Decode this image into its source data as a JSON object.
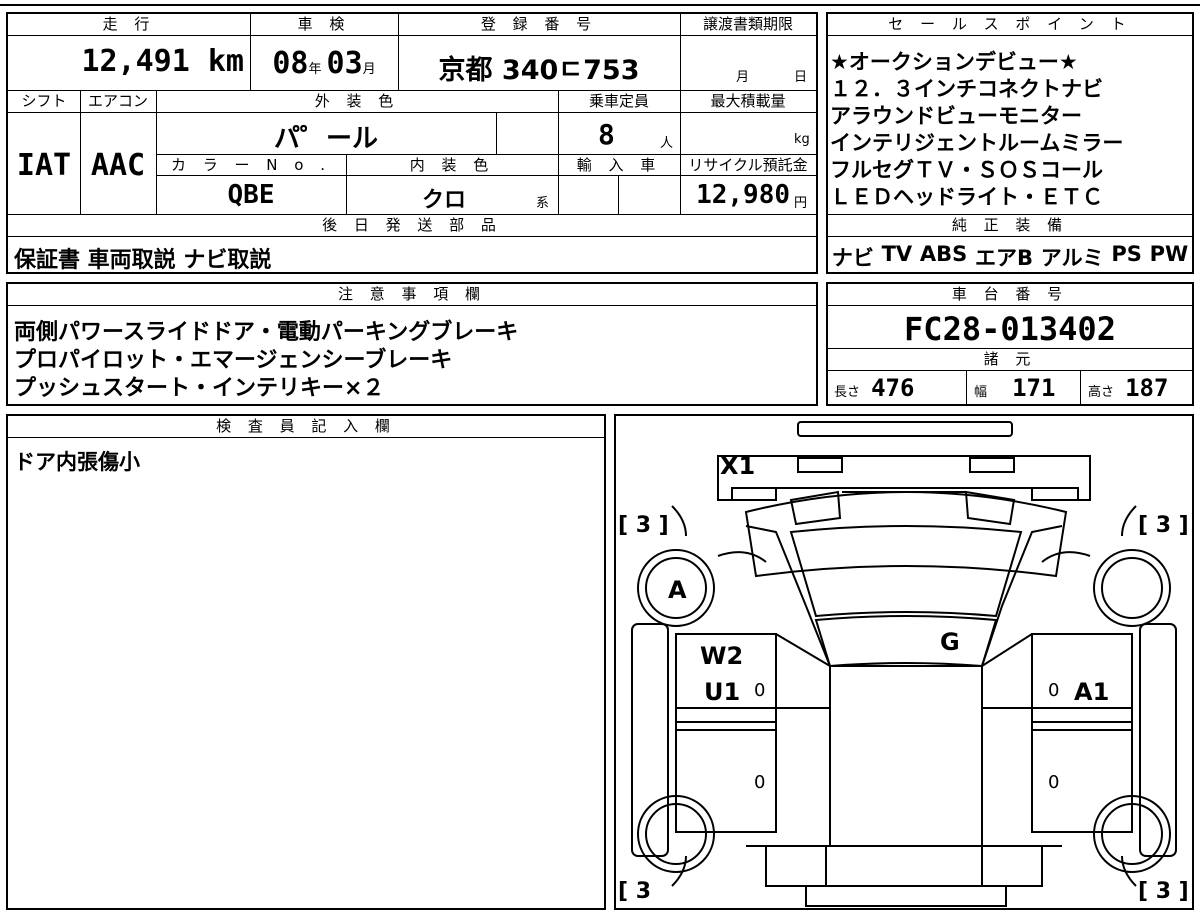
{
  "top_section": {
    "headers": {
      "mileage": "走 行",
      "inspection": "車 検",
      "registration": "登 録 番 号",
      "transfer_deadline": "譲渡書類期限",
      "shift": "シフト",
      "aircon": "エアコン",
      "exterior_color": "外 装 色",
      "capacity": "乗車定員",
      "max_load": "最大積載量",
      "color_no": "カ ラ ー N o .",
      "interior_color": "内 装 色",
      "import": "輸 入 車",
      "recycle_fee": "リサイクル預託金",
      "later_parts": "後 日 発 送 部 品"
    },
    "mileage_value": "12,491 km",
    "inspection_year": "08",
    "inspection_year_unit": "年",
    "inspection_month": "03",
    "inspection_month_unit": "月",
    "registration_value": "京都 340ㄷ753",
    "deadline_month_unit": "月",
    "deadline_day_unit": "日",
    "shift_value": "IAT",
    "aircon_value": "AAC",
    "exterior_value": "パ゜ール",
    "capacity_value": "8",
    "capacity_unit": "人",
    "load_unit": "kg",
    "color_no_value": "QBE",
    "interior_value": "クロ",
    "interior_suffix": "系",
    "recycle_value": "12,980",
    "recycle_unit": "円",
    "later_parts_value": "保証書 車両取説 ナビ取説"
  },
  "sales_points": {
    "header": "セ ー ル ス ポ イ ン ト",
    "lines": [
      "★オークションデビュー★",
      "１２．３インチコネクトナビ",
      "アラウンドビューモニター",
      "インテリジェントルームミラー",
      "フルセグＴＶ・ＳＯＳコール",
      "ＬＥＤヘッドライト・ＥＴＣ"
    ]
  },
  "equipment": {
    "header": "純 正 装 備",
    "items": [
      "ナビ",
      "TV",
      "ABS",
      "エアB",
      "アルミ",
      "PS",
      "PW"
    ]
  },
  "notes": {
    "header": "注 意 事 項 欄",
    "lines": [
      "両側パワースライドドア・電動パーキングブレーキ",
      "プロパイロット・エマージェンシーブレーキ",
      "プッシュスタート・インテリキー×２"
    ]
  },
  "chassis": {
    "header": "車 台 番 号",
    "value": "FC28-013402"
  },
  "specs": {
    "header": "諸 元",
    "length_label": "長さ",
    "length_value": "476",
    "width_label": "幅",
    "width_value": "171",
    "height_label": "高さ",
    "height_value": "187"
  },
  "inspector": {
    "header": "検 査 員 記 入 欄",
    "comment": "ドア内張傷小"
  },
  "diagram": {
    "marks": {
      "x1": "X1",
      "a": "A",
      "w2": "W2",
      "u1": "U1",
      "g": "G",
      "a1": "A1"
    },
    "tire_tl": "[ 3 ]",
    "tire_tr": "[ 3 ]",
    "tire_bl": "[ 3",
    "tire_br": "[ 3 ]",
    "zero": "0"
  }
}
